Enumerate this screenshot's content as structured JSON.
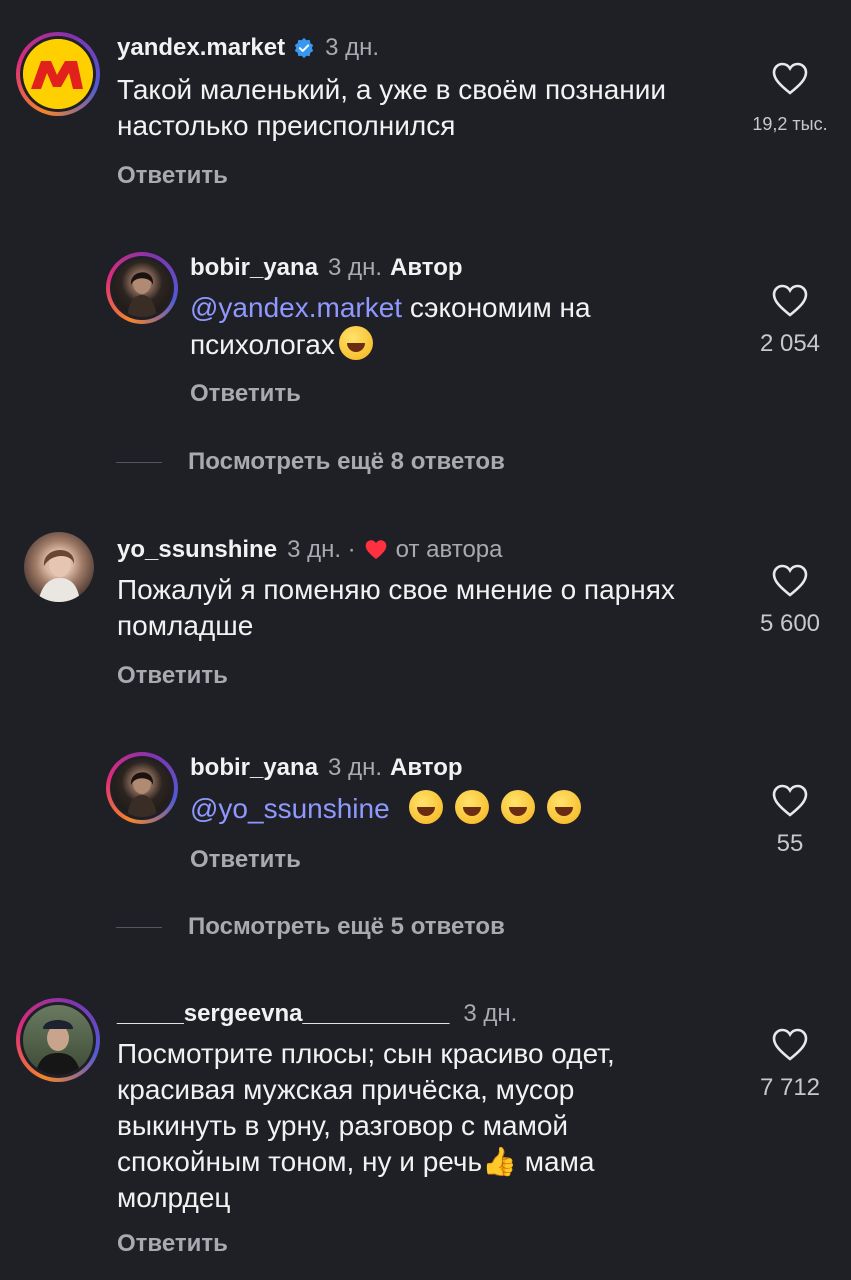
{
  "comments": [
    {
      "username": "yandex.market",
      "time": "3 дн.",
      "text": "Такой маленький, а уже в своём познании настолько преисполнился",
      "reply": "Ответить",
      "likes": "19,2 тыс.",
      "icon": "verified-badge-icon"
    },
    {
      "username": "bobir_yana",
      "time": "3 дн.",
      "author_label": "Автор",
      "mention": "@yandex.market",
      "text": " сэкономим на психологах",
      "reply": "Ответить",
      "likes": "2 054",
      "more": "Посмотреть ещё 8 ответов"
    },
    {
      "username": "yo_ssunshine",
      "time": "3 дн. ·",
      "liked_by_author": "от автора",
      "text": "Пожалуй я поменяю свое мнение о парнях помладше",
      "reply": "Ответить",
      "likes": "5 600"
    },
    {
      "username": "bobir_yana",
      "time": "3 дн.",
      "author_label": "Автор",
      "mention": "@yo_ssunshine",
      "reply": "Ответить",
      "likes": "55",
      "more": "Посмотреть ещё 5 ответов"
    },
    {
      "username": "_____sergeevna___________",
      "time": "3 дн.",
      "text_a": "Посмотрите плюсы; сын красиво одет, красивая мужская причёска, мусор выкинуть в урну, разговор с мамой спокойным тоном, ну и речь",
      "text_b": " мама молрдец",
      "reply": "Ответить",
      "likes": "7 712"
    }
  ],
  "colors": {
    "background": "#1f2026",
    "mention": "#8f98ff",
    "verified": "#3897f0",
    "heart_red": "#ff3040"
  }
}
